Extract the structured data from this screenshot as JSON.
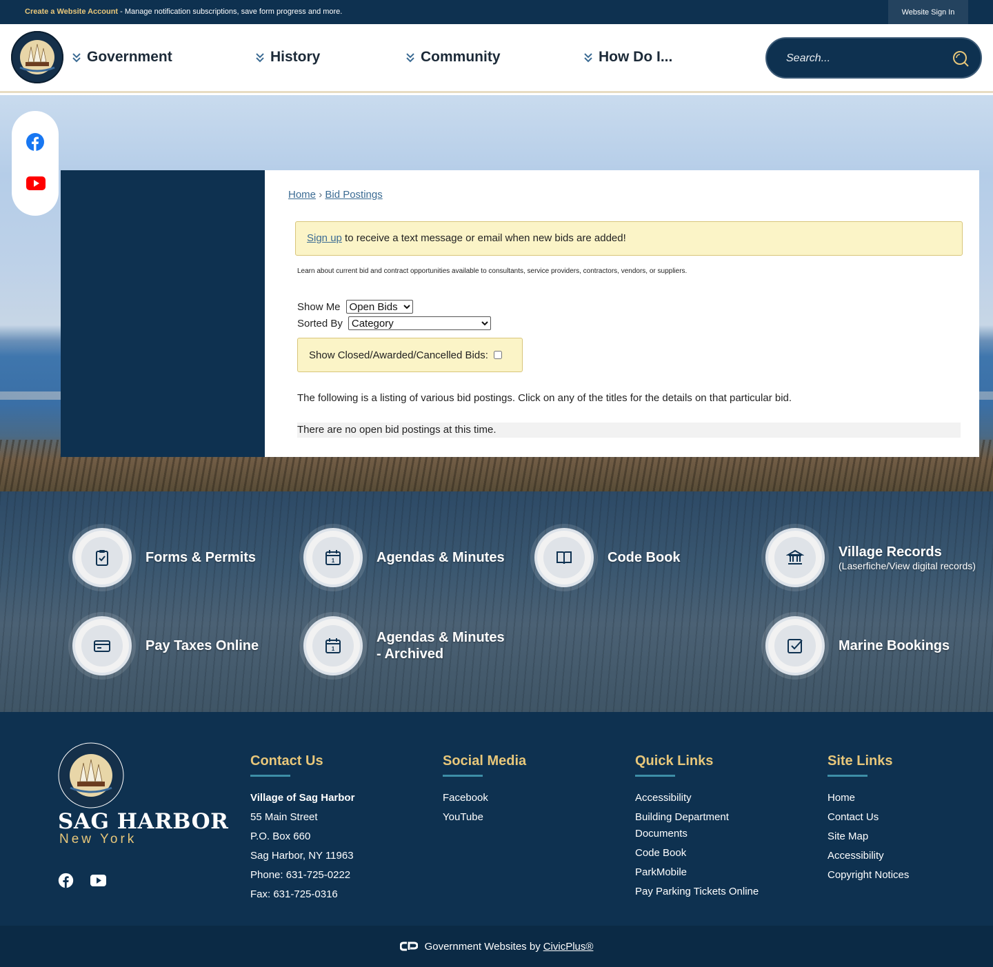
{
  "topbar": {
    "create_account": "Create a Website Account",
    "message": " - Manage notification subscriptions, save form progress and more.",
    "signin": "Website Sign In"
  },
  "nav": {
    "items": [
      "Government",
      "History",
      "Community",
      "How Do I..."
    ]
  },
  "search": {
    "placeholder": "Search..."
  },
  "breadcrumb": {
    "home": "Home",
    "separator": "›",
    "current": "Bid Postings"
  },
  "notice": {
    "link": "Sign up",
    "text": " to receive a text message or email when new bids are added!"
  },
  "intro": "Learn about current bid and contract opportunities available to consultants, service providers, contractors, vendors, or suppliers.",
  "filters": {
    "show_me_label": "Show Me",
    "show_me_value": "Open Bids",
    "sorted_by_label": "Sorted By",
    "sorted_by_value": "Category",
    "closed_label": "Show Closed/Awarded/Cancelled Bids:"
  },
  "listing_text": "The following is a listing of various bid postings. Click on any of the titles for the details on that particular bid.",
  "no_bids": "There are no open bid postings at this time.",
  "quick_links": [
    {
      "label": "Forms & Permits",
      "icon": "clipboard-icon"
    },
    {
      "label": "Agendas & Minutes",
      "icon": "calendar-icon"
    },
    {
      "label": "Code Book",
      "icon": "book-icon"
    },
    {
      "label": "Village Records",
      "sub": "(Laserfiche/View digital records)",
      "icon": "building-icon"
    },
    {
      "label": "Pay Taxes Online",
      "icon": "credit-card-icon"
    },
    {
      "label": "Agendas & Minutes - Archived",
      "icon": "calendar-icon"
    },
    {
      "label": "Marine Bookings",
      "icon": "checkbox-icon"
    }
  ],
  "footer": {
    "brand": "SAG HARBOR",
    "brand_sub": "New York",
    "contact": {
      "title": "Contact Us",
      "lines": [
        "Village of Sag Harbor",
        "55 Main Street",
        "P.O. Box 660",
        "Sag Harbor, NY 11963",
        "Phone: 631-725-0222",
        "Fax: 631-725-0316"
      ]
    },
    "social": {
      "title": "Social Media",
      "items": [
        "Facebook",
        "YouTube"
      ]
    },
    "quick": {
      "title": "Quick Links",
      "items": [
        "Accessibility",
        "Building Department Documents",
        "Code Book",
        "ParkMobile",
        "Pay Parking Tickets Online"
      ]
    },
    "site": {
      "title": "Site Links",
      "items": [
        "Home",
        "Contact Us",
        "Site Map",
        "Accessibility",
        "Copyright Notices"
      ]
    }
  },
  "copyright": {
    "text": "Government Websites by",
    "link": "CivicPlus®"
  },
  "colors": {
    "navy": "#0e3150",
    "gold": "#e8c77a",
    "notice_bg": "#fbf4c7"
  }
}
